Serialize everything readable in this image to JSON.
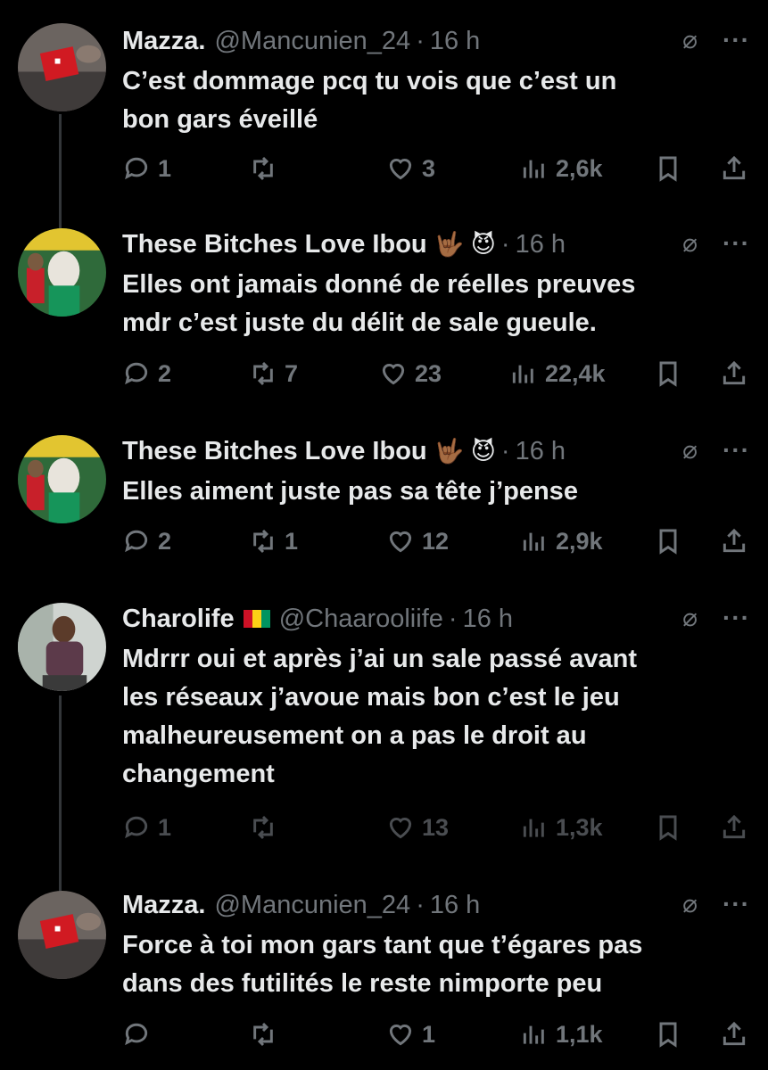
{
  "tweets": [
    {
      "name": "Mazza.",
      "handle": "@Mancunien_24",
      "dot": "·",
      "time": "16 h",
      "emoji": "",
      "lines": [
        "C’est dommage pcq tu vois que c’est un",
        "bon gars éveillé"
      ],
      "replies": "1",
      "retweets": "",
      "likes": "3",
      "views": "2,6k"
    },
    {
      "name": "These Bitches Love Ibou",
      "handle": "",
      "dot": "·",
      "time": "16 h",
      "emoji": "🤟🏾 😈",
      "lines": [
        "Elles ont jamais donné de réelles preuves",
        "mdr c’est juste du délit de sale gueule."
      ],
      "replies": "2",
      "retweets": "7",
      "likes": "23",
      "views": "22,4k"
    },
    {
      "name": "These Bitches Love Ibou",
      "handle": "",
      "dot": "·",
      "time": "16 h",
      "emoji": "🤟🏾 😈",
      "lines": [
        "Elles aiment juste pas sa tête j’pense"
      ],
      "replies": "2",
      "retweets": "1",
      "likes": "12",
      "views": "2,9k"
    },
    {
      "name": "Charolife",
      "handle": "@Chaarooliife",
      "dot": "·",
      "time": "16 h",
      "emoji": "",
      "lines": [
        "Mdrrr oui et après j’ai un sale passé avant",
        "les réseaux j’avoue mais bon c’est le jeu",
        "malheureusement on a pas le droit au",
        "changement"
      ],
      "replies": "1",
      "retweets": "",
      "likes": "13",
      "views": "1,3k"
    },
    {
      "name": "Mazza.",
      "handle": "@Mancunien_24",
      "dot": "·",
      "time": "16 h",
      "emoji": "",
      "lines": [
        "Force à toi mon gars tant que t’égares pas",
        "dans des futilités le reste nimporte peu"
      ],
      "replies": "",
      "retweets": "",
      "likes": "1",
      "views": "1,1k"
    }
  ],
  "icons": {
    "reply": "reply-icon",
    "retweet": "retweet-icon",
    "like": "heart-icon",
    "views": "views-icon",
    "bookmark": "bookmark-icon",
    "share": "share-icon",
    "grok": "grok-icon",
    "more": "more-icon"
  },
  "colors": {
    "background": "#000000",
    "text": "#e7e9ea",
    "muted": "#71767b"
  }
}
